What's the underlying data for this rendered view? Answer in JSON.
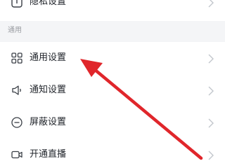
{
  "rows": {
    "privacy": {
      "label": "隐私设置",
      "icon": "lock-info-icon"
    },
    "section_title": "通用",
    "general": {
      "label": "通用设置",
      "icon": "grid-icon"
    },
    "notify": {
      "label": "通知设置",
      "icon": "speaker-icon"
    },
    "block": {
      "label": "屏蔽设置",
      "icon": "minus-circle-icon"
    },
    "live": {
      "label": "开通直播",
      "icon": "video-camera-icon"
    }
  },
  "colors": {
    "text": "#1f2329",
    "section_bg": "#f4f5f7",
    "muted": "#9a9da2",
    "chevron": "#c2c6cc",
    "annotation_arrow": "#e0262b"
  }
}
